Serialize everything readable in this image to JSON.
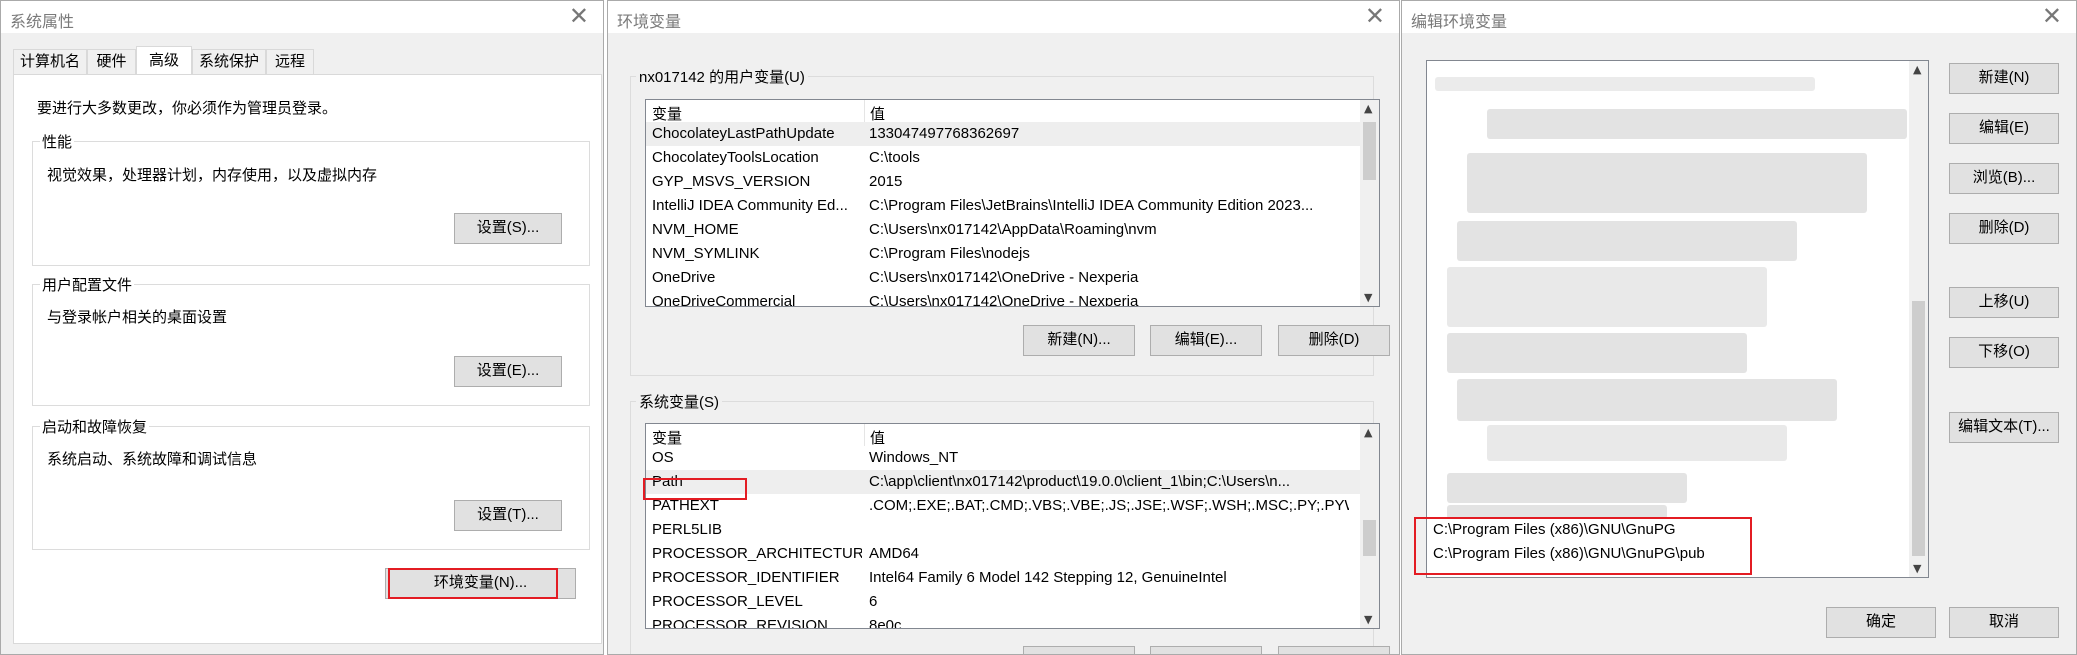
{
  "sysprops": {
    "title": "系统属性",
    "tabs": [
      "计算机名",
      "硬件",
      "高级",
      "系统保护",
      "远程"
    ],
    "admin_note": "要进行大多数更改，你必须作为管理员登录。",
    "performance": {
      "title": "性能",
      "desc": "视觉效果，处理器计划，内存使用，以及虚拟内存",
      "button": "设置(S)..."
    },
    "profiles": {
      "title": "用户配置文件",
      "desc": "与登录帐户相关的桌面设置",
      "button": "设置(E)..."
    },
    "startup": {
      "title": "启动和故障恢复",
      "desc": "系统启动、系统故障和调试信息",
      "button": "设置(T)..."
    },
    "env_button": "环境变量(N)..."
  },
  "envvars": {
    "title": "环境变量",
    "user_group": "nx017142 的用户变量(U)",
    "col_var": "变量",
    "col_val": "值",
    "user_rows": [
      [
        "ChocolateyLastPathUpdate",
        "133047497768362697"
      ],
      [
        "ChocolateyToolsLocation",
        "C:\\tools"
      ],
      [
        "GYP_MSVS_VERSION",
        "2015"
      ],
      [
        "IntelliJ IDEA Community Ed...",
        "C:\\Program Files\\JetBrains\\IntelliJ IDEA Community Edition 2023..."
      ],
      [
        "NVM_HOME",
        "C:\\Users\\nx017142\\AppData\\Roaming\\nvm"
      ],
      [
        "NVM_SYMLINK",
        "C:\\Program Files\\nodejs"
      ],
      [
        "OneDrive",
        "C:\\Users\\nx017142\\OneDrive - Nexperia"
      ],
      [
        "OneDriveCommercial",
        "C:\\Users\\nx017142\\OneDrive - Nexperia"
      ]
    ],
    "user_buttons": [
      "新建(N)...",
      "编辑(E)...",
      "删除(D)"
    ],
    "sys_group": "系统变量(S)",
    "sys_rows": [
      [
        "OS",
        "Windows_NT"
      ],
      [
        "Path",
        "C:\\app\\client\\nx017142\\product\\19.0.0\\client_1\\bin;C:\\Users\\n..."
      ],
      [
        "PATHEXT",
        ".COM;.EXE;.BAT;.CMD;.VBS;.VBE;.JS;.JSE;.WSF;.WSH;.MSC;.PY;.PYW"
      ],
      [
        "PERL5LIB",
        ""
      ],
      [
        "PROCESSOR_ARCHITECTURE",
        "AMD64"
      ],
      [
        "PROCESSOR_IDENTIFIER",
        "Intel64 Family 6 Model 142 Stepping 12, GenuineIntel"
      ],
      [
        "PROCESSOR_LEVEL",
        "6"
      ],
      [
        "PROCESSOR_REVISION",
        "8e0c"
      ]
    ]
  },
  "editenv": {
    "title": "编辑环境变量",
    "visible_entries": [
      "C:\\Program Files (x86)\\GNU\\GnuPG",
      "C:\\Program Files (x86)\\GNU\\GnuPG\\pub"
    ],
    "buttons": {
      "new": "新建(N)",
      "edit": "编辑(E)",
      "browse": "浏览(B)...",
      "delete": "删除(D)",
      "up": "上移(U)",
      "down": "下移(O)",
      "edit_text": "编辑文本(T)...",
      "ok": "确定",
      "cancel": "取消"
    }
  },
  "icons": {
    "close": "close-icon",
    "scroll_up": "chevron-up-icon",
    "scroll_down": "chevron-down-icon"
  },
  "colors": {
    "highlight": "#e31c23",
    "window_bg": "#f0f0f0",
    "button_bg": "#e1e1e1"
  }
}
